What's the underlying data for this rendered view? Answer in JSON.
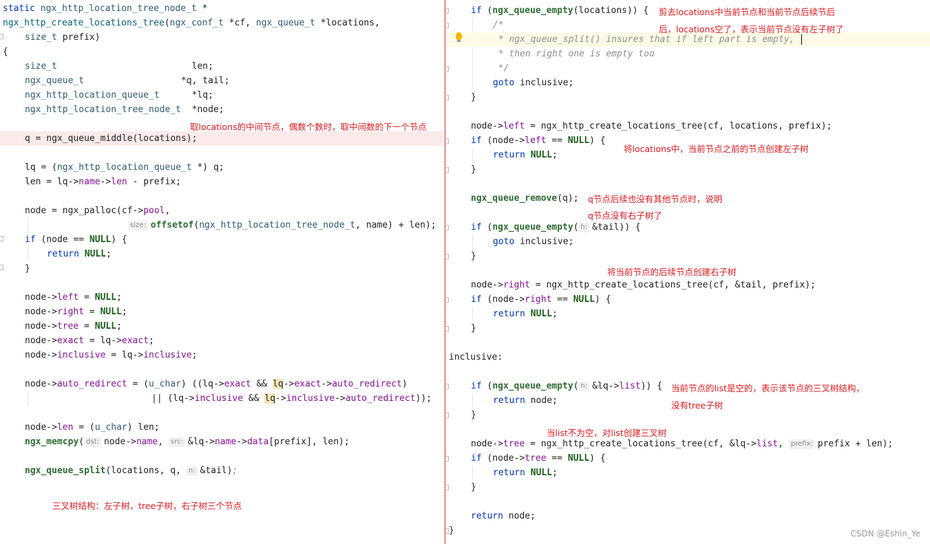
{
  "left": {
    "l1": {
      "a": "static ",
      "b": "ngx_http_location_tree_node_t",
      "c": " *"
    },
    "l2": {
      "a": "ngx_http_create_locations_tree",
      "b": "(",
      "c": "ngx_conf_t",
      "d": " *cf, ",
      "e": "ngx_queue_t",
      "f": " *locations,"
    },
    "l3": {
      "a": "size_t",
      "b": " prefix)"
    },
    "l4": "{",
    "l5": {
      "a": "size_t",
      "b": "                         len;"
    },
    "l6": {
      "a": "ngx_queue_t",
      "b": "                  *q, tail;"
    },
    "l7": {
      "a": "ngx_http_location_queue_t",
      "b": "      *lq;"
    },
    "l8": {
      "a": "ngx_http_location_tree_node_t",
      "b": "  *node;"
    },
    "l9": {
      "a": "q = ngx_queue_middle(locations);"
    },
    "l10": {
      "a": "lq = (",
      "b": "ngx_http_location_queue_t",
      "c": " *) q;"
    },
    "l11": {
      "a": "len = lq->",
      "b": "name",
      "c": "->",
      "d": "len",
      "e": " - prefix;"
    },
    "l12": {
      "a": "node = ngx_palloc(cf->",
      "b": "pool",
      "c": ","
    },
    "l13": {
      "hint": "size:",
      "a": "offsetof",
      "b": "(",
      "c": "ngx_http_location_tree_node_t",
      "d": ", name) + len);"
    },
    "l14": {
      "a": "if",
      "b": " (node == ",
      "c": "NULL",
      "d": ") {"
    },
    "l15": {
      "a": "return",
      "b": " ",
      "c": "NULL",
      "d": ";"
    },
    "l16": "}",
    "l17": {
      "a": "node->",
      "b": "left",
      "c": " = ",
      "d": "NULL",
      "e": ";"
    },
    "l18": {
      "a": "node->",
      "b": "right",
      "c": " = ",
      "d": "NULL",
      "e": ";"
    },
    "l19": {
      "a": "node->",
      "b": "tree",
      "c": " = ",
      "d": "NULL",
      "e": ";"
    },
    "l20": {
      "a": "node->",
      "b": "exact",
      "c": " = lq->",
      "d": "exact",
      "e": ";"
    },
    "l21": {
      "a": "node->",
      "b": "inclusive",
      "c": " = lq->",
      "d": "inclusive",
      "e": ";"
    },
    "l22": {
      "a": "node->",
      "b": "auto_redirect",
      "c": " = (",
      "d": "u_char",
      "e": ") ((lq->",
      "f": "exact",
      "g": " && ",
      "h": "lq",
      "i": "->",
      "j": "exact",
      "k": "->",
      "l": "auto_redirect",
      "m": ")"
    },
    "l23": {
      "a": "|| (lq->",
      "b": "inclusive",
      "c": " && ",
      "d": "lq",
      "e": "->",
      "f": "inclusive",
      "g": "->",
      "h": "auto_redirect",
      "i": "));"
    },
    "l24": {
      "a": "node->",
      "b": "len",
      "c": " = (",
      "d": "u_char",
      "e": ") len;"
    },
    "l25": {
      "a": "ngx_memcpy",
      "b": "(",
      "hint1": "dst:",
      "c": "node->",
      "d": "name",
      "e": ", ",
      "hint2": "src:",
      "f": "&lq->",
      "g": "name",
      "h": "->",
      "i": "data",
      "j": "[prefix], len);"
    },
    "l26": {
      "a": "ngx_queue_split",
      "b": "(locations, q, ",
      "hint": "n:",
      "c": "&tail)",
      "d": ";"
    }
  },
  "right": {
    "r1": {
      "a": "if",
      "b": " (",
      "c": "ngx_queue_empty",
      "d": "(locations)) {"
    },
    "r2": "/*",
    "r3": " * ngx_queue_split() insures that if left part is empty,",
    "r4": " * then right one is empty too",
    "r5": " */",
    "r6": {
      "a": "goto",
      "b": " inclusive;"
    },
    "r7": "}",
    "r8": {
      "a": "node->",
      "b": "left",
      "c": " = ngx_http_create_locations_tree(cf, locations, prefix);"
    },
    "r9": {
      "a": "if",
      "b": " (node->",
      "c": "left",
      "d": " == ",
      "e": "NULL",
      "f": ") {"
    },
    "r10": {
      "a": "return",
      "b": " ",
      "c": "NULL",
      "d": ";"
    },
    "r11": "}",
    "r12": {
      "a": "ngx_queue_remove",
      "b": "(q);"
    },
    "r13": {
      "a": "if",
      "b": " (",
      "c": "ngx_queue_empty",
      "d": "(",
      "hint": "h:",
      "e": "&tail)) {"
    },
    "r14": {
      "a": "goto",
      "b": " inclusive;"
    },
    "r15": "}",
    "r16": {
      "a": "node->",
      "b": "right",
      "c": " = ngx_http_create_locations_tree(cf, &tail, prefix);"
    },
    "r17": {
      "a": "if",
      "b": " (node->",
      "c": "right",
      "d": " == ",
      "e": "NULL",
      "f": ") {"
    },
    "r18": {
      "a": "return",
      "b": " ",
      "c": "NULL",
      "d": ";"
    },
    "r19": "}",
    "r20": "inclusive:",
    "r21": {
      "a": "if",
      "b": " (",
      "c": "ngx_queue_empty",
      "d": "(",
      "hint": "h:",
      "e": "&lq->",
      "f": "list",
      "g": ")) {"
    },
    "r22": {
      "a": "return",
      "b": " node;"
    },
    "r23": "}",
    "r24": {
      "a": "node->",
      "b": "tree",
      "c": " = ngx_http_create_locations_tree(cf, &lq->",
      "d": "list",
      "e": ", ",
      "hint": "prefix:",
      "f": "prefix + len);"
    },
    "r25": {
      "a": "if",
      "b": " (node->",
      "c": "tree",
      "d": " == ",
      "e": "NULL",
      "f": ") {"
    },
    "r26": {
      "a": "return",
      "b": " ",
      "c": "NULL",
      "d": ";"
    },
    "r27": "}",
    "r28": {
      "a": "return",
      "b": " node;"
    },
    "r29": "}"
  },
  "annotations": {
    "a_middle": "取locations的中间节点，偶数个数时，取中间数的下一个节点",
    "a_tri": "三叉树结构：左子树，tree子树，右子树三个节点",
    "a_cut1": "剪去locations中当前节点和当前节点后续节后",
    "a_cut2": "后，locations空了，表示当前节点没有左子树了",
    "a_left": "将locations中，当前节点之前的节点创建左子树",
    "a_q1": "q节点后续也没有其他节点时，说明",
    "a_q2": "q节点没有右子树了",
    "a_right": "将当前节点的后续节点创建右子树",
    "a_list1": "当前节点的list是空的，表示该节点的三叉树结构，",
    "a_list2": "没有tree子树",
    "a_tree": "当list不为空，对list创建三叉树"
  },
  "watermark": "CSDN @Eshin_Ye",
  "colors": {
    "keyword": "#0033b3",
    "type": "#2d5b73",
    "field": "#871094",
    "annotation": "#e0191f",
    "comment": "#8c8c8c"
  }
}
